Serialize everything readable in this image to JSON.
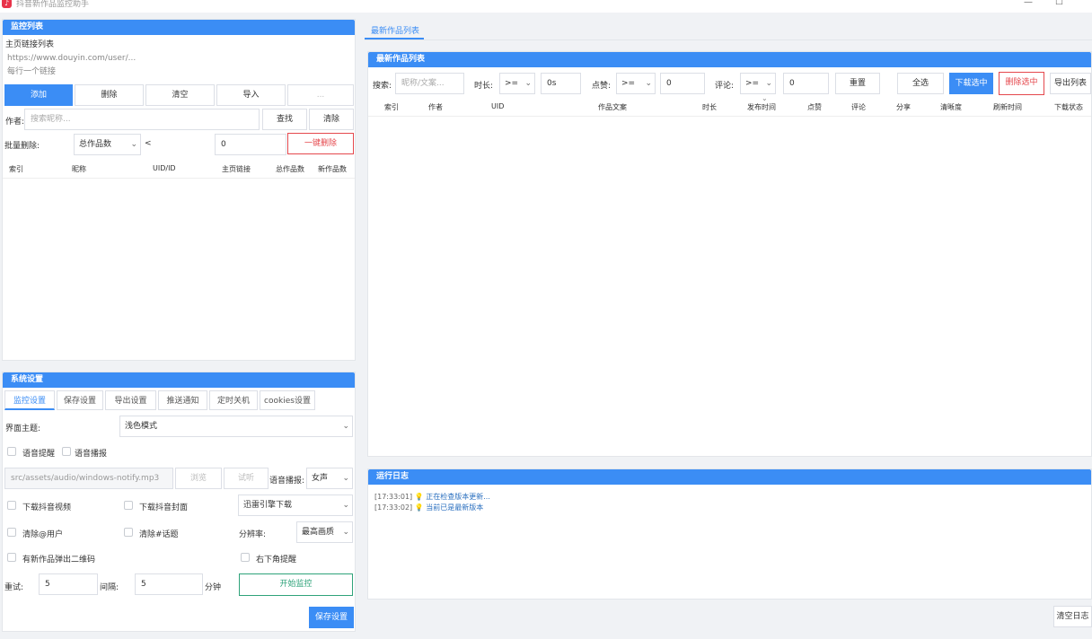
{
  "window": {
    "title": "抖音新作品监控助手",
    "minimize": "—",
    "maximize": "☐"
  },
  "monitor": {
    "header": "监控列表",
    "home_link_label": "主页链接列表",
    "textarea_placeholder_line1": "https://www.douyin.com/user/...",
    "textarea_placeholder_line2": "每行一个链接",
    "buttons": {
      "add": "添加",
      "delete": "删除",
      "clear": "清空",
      "import": "导入",
      "extra": "..."
    },
    "author_label": "作者:",
    "author_placeholder": "搜索昵称...",
    "find_button": "查找",
    "clear_button": "清除",
    "batch_label": "批量删除:",
    "batch_field": "总作品数",
    "batch_op": "<",
    "batch_value": "0",
    "batch_delete_button": "一键删除",
    "columns": [
      "索引",
      "昵称",
      "UID/ID",
      "主页链接",
      "总作品数",
      "新作品数"
    ]
  },
  "settings": {
    "header": "系统设置",
    "tabs": [
      "监控设置",
      "保存设置",
      "导出设置",
      "推送通知",
      "定时关机",
      "cookies设置"
    ],
    "theme_label": "界面主题:",
    "theme_value": "浅色模式",
    "voice_alert": "语音提醒",
    "voice_broadcast": "语音播报",
    "audio_path": "src/assets/audio/windows-notify.mp3",
    "browse_btn": "浏览",
    "test_btn": "试听",
    "voice_label": "语音播报:",
    "voice_value": "女声",
    "download_video": "下载抖音视频",
    "download_cover": "下载抖音封面",
    "downloader_value": "迅雷引擎下载",
    "clean_at": "清除@用户",
    "clean_topic": "清除#话题",
    "resolution_label": "分辨率:",
    "resolution_value": "最高画质",
    "qr_popup": "有新作品弹出二维码",
    "corner_notify": "右下角提醒",
    "retry_label": "重试:",
    "retry_value": "5",
    "interval_label": "间隔:",
    "interval_value": "5",
    "minute_unit": "分钟",
    "start_button": "开始监控",
    "save_button": "保存设置"
  },
  "works": {
    "tab_label": "最新作品列表",
    "header": "最新作品列表",
    "search_label": "搜索:",
    "search_placeholder": "昵称/文案...",
    "duration_label": "时长:",
    "duration_op": ">=",
    "duration_value": "0s",
    "likes_label": "点赞:",
    "likes_op": ">=",
    "likes_value": "0",
    "comments_label": "评论:",
    "comments_op": ">=",
    "comments_value": "0",
    "reset_button": "重置",
    "select_all_button": "全选",
    "download_selected_button": "下载选中",
    "delete_selected_button": "删除选中",
    "export_button": "导出列表",
    "columns": [
      "索引",
      "作者",
      "UID",
      "作品文案",
      "时长",
      "发布时间",
      "点赞",
      "评论",
      "分享",
      "清晰度",
      "刷新时间",
      "下载状态"
    ],
    "sort_indicator": "⌄"
  },
  "log": {
    "header": "运行日志",
    "entries": [
      {
        "time": "[17:33:01]",
        "text": "正在检查版本更新..."
      },
      {
        "time": "[17:33:02]",
        "text": "当前已是最新版本"
      }
    ],
    "clear_button": "清空日志"
  }
}
